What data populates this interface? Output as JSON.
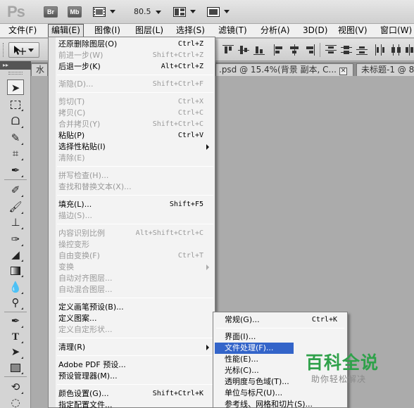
{
  "app": {
    "logo": "Ps",
    "bridge_label": "Br",
    "minibridge_label": "Mb",
    "zoom": "80.5"
  },
  "menubar": [
    {
      "label": "文件(F)"
    },
    {
      "label": "编辑(E)"
    },
    {
      "label": "图像(I)"
    },
    {
      "label": "图层(L)"
    },
    {
      "label": "选择(S)"
    },
    {
      "label": "滤镜(T)"
    },
    {
      "label": "分析(A)"
    },
    {
      "label": "3D(D)"
    },
    {
      "label": "视图(V)"
    },
    {
      "label": "窗口(W)"
    }
  ],
  "tabs": [
    {
      "label": "水"
    },
    {
      "label": ".psd @ 15.4%(背景 副本, C..."
    },
    {
      "label": "未标题-1 @ 8"
    }
  ],
  "edit_menu": [
    {
      "label": "还原删除图层(O)",
      "shortcut": "Ctrl+Z"
    },
    {
      "label": "前进一步(W)",
      "shortcut": "Shift+Ctrl+Z"
    },
    {
      "label": "后退一步(K)",
      "shortcut": "Alt+Ctrl+Z"
    },
    {
      "label": "渐隐(D)...",
      "shortcut": "Shift+Ctrl+F"
    },
    {
      "label": "剪切(T)",
      "shortcut": "Ctrl+X"
    },
    {
      "label": "拷贝(C)",
      "shortcut": "Ctrl+C"
    },
    {
      "label": "合并拷贝(Y)",
      "shortcut": "Shift+Ctrl+C"
    },
    {
      "label": "粘贴(P)",
      "shortcut": "Ctrl+V"
    },
    {
      "label": "选择性粘贴(I)",
      "shortcut": ""
    },
    {
      "label": "清除(E)",
      "shortcut": ""
    },
    {
      "label": "拼写检查(H)...",
      "shortcut": ""
    },
    {
      "label": "查找和替换文本(X)...",
      "shortcut": ""
    },
    {
      "label": "填充(L)...",
      "shortcut": "Shift+F5"
    },
    {
      "label": "描边(S)...",
      "shortcut": ""
    },
    {
      "label": "内容识别比例",
      "shortcut": "Alt+Shift+Ctrl+C"
    },
    {
      "label": "操控变形",
      "shortcut": ""
    },
    {
      "label": "自由变换(F)",
      "shortcut": "Ctrl+T"
    },
    {
      "label": "变换",
      "shortcut": ""
    },
    {
      "label": "自动对齐图层...",
      "shortcut": ""
    },
    {
      "label": "自动混合图层...",
      "shortcut": ""
    },
    {
      "label": "定义画笔预设(B)...",
      "shortcut": ""
    },
    {
      "label": "定义图案...",
      "shortcut": ""
    },
    {
      "label": "定义自定形状...",
      "shortcut": ""
    },
    {
      "label": "清理(R)",
      "shortcut": ""
    },
    {
      "label": "Adobe PDF 预设...",
      "shortcut": ""
    },
    {
      "label": "预设管理器(M)...",
      "shortcut": ""
    },
    {
      "label": "颜色设置(G)...",
      "shortcut": "Shift+Ctrl+K"
    },
    {
      "label": "指定配置文件...",
      "shortcut": ""
    }
  ],
  "prefs_menu": [
    {
      "label": "常规(G)...",
      "shortcut": "Ctrl+K"
    },
    {
      "label": "界面(I)...",
      "shortcut": ""
    },
    {
      "label": "文件处理(F)...",
      "shortcut": ""
    },
    {
      "label": "性能(E)...",
      "shortcut": ""
    },
    {
      "label": "光标(C)...",
      "shortcut": ""
    },
    {
      "label": "透明度与色域(T)...",
      "shortcut": ""
    },
    {
      "label": "单位与标尺(U)...",
      "shortcut": ""
    },
    {
      "label": "参考线、网格和切片(S)...",
      "shortcut": ""
    }
  ],
  "watermark": {
    "title": "百科全说",
    "subtitle": "助你轻松解决"
  }
}
